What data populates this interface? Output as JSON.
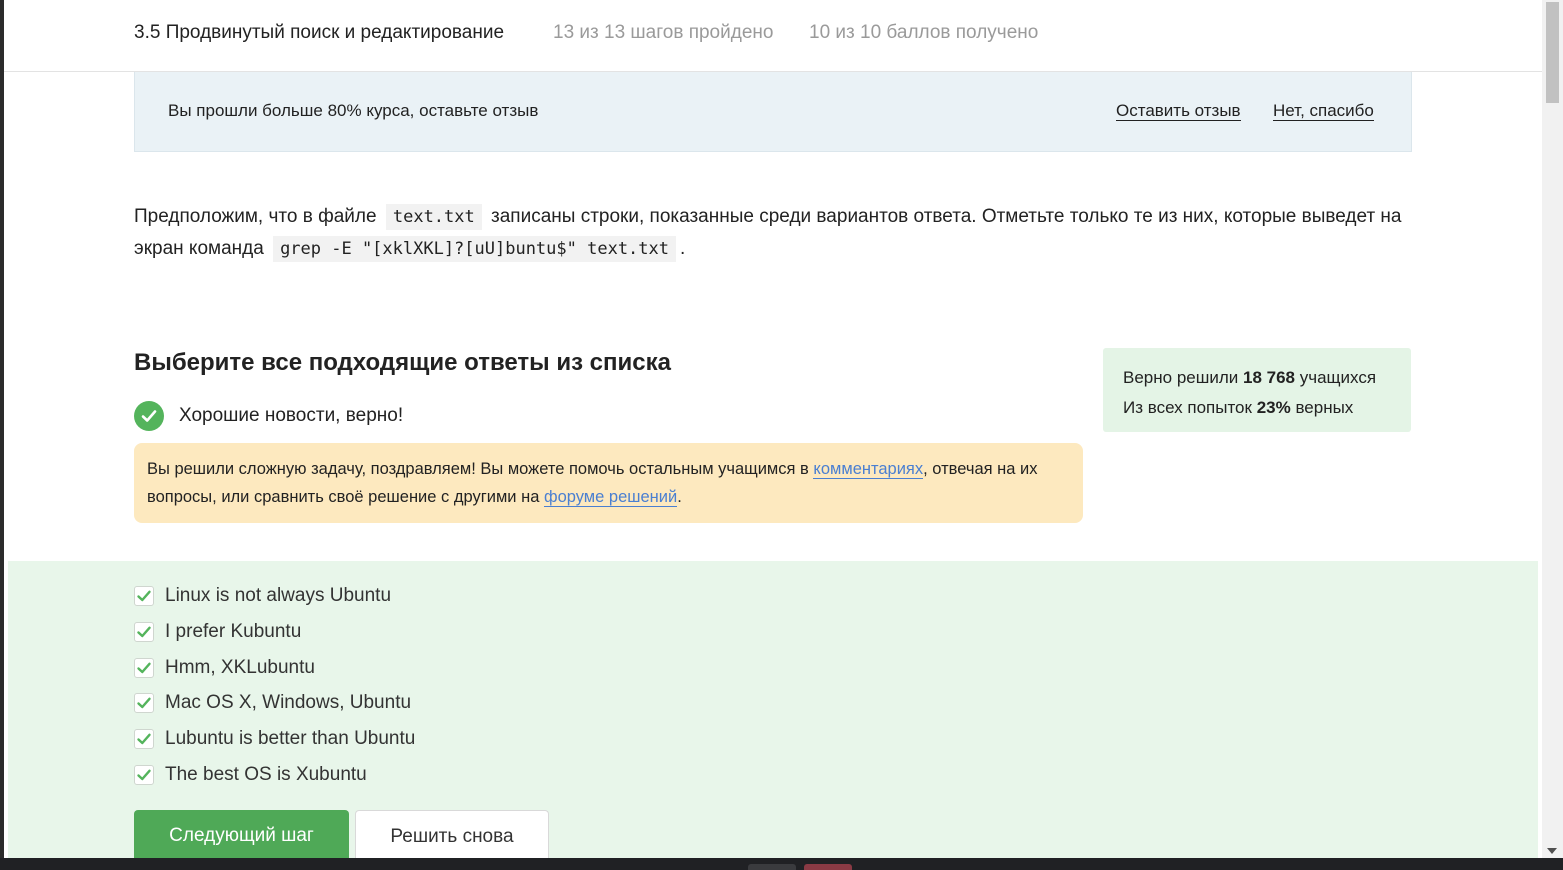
{
  "header": {
    "lesson_title": "3.5 Продвинутый поиск и редактирование",
    "steps_progress": "13 из 13 шагов пройдено",
    "score_progress": "10 из 10 баллов  получено"
  },
  "review_banner": {
    "text": "Вы прошли больше 80% курса, оставьте отзыв",
    "leave_review": "Оставить отзыв",
    "no_thanks": "Нет, спасибо"
  },
  "question": {
    "part1": "Предположим, что в файле",
    "filename": "text.txt",
    "part2": "записаны строки, показанные среди вариантов ответа. Отметьте только те из них, которые выведет на экран команда",
    "command": "grep -E \"[xklXKL]?[uU]buntu$\" text.txt",
    "part3": "."
  },
  "choice_heading": "Выберите все подходящие ответы из списка",
  "result": {
    "text": "Хорошие новости, верно!"
  },
  "stats": {
    "solved_prefix": "Верно решили",
    "solved_count": "18 768",
    "solved_suffix": "учащихся",
    "attempts_prefix": "Из всех попыток",
    "attempts_percent": "23%",
    "attempts_suffix": "верных"
  },
  "notice": {
    "part1": "Вы решили сложную задачу, поздравляем! Вы можете помочь остальным учащимся в",
    "comments_link": "комментариях",
    "part2": ", отвечая на их вопросы, или сравнить своё решение с другими на",
    "forum_link": "форуме решений",
    "part3": "."
  },
  "answers": [
    {
      "label": "Linux is not always Ubuntu",
      "checked": true
    },
    {
      "label": "I prefer Kubuntu",
      "checked": true
    },
    {
      "label": "Hmm, XKLubuntu",
      "checked": true
    },
    {
      "label": "Mac OS X, Windows, Ubuntu",
      "checked": true
    },
    {
      "label": "Lubuntu is better than Ubuntu",
      "checked": true
    },
    {
      "label": "The best OS is Xubuntu",
      "checked": true
    }
  ],
  "buttons": {
    "next_step": "Следующий шаг",
    "solve_again": "Решить снова"
  },
  "colors": {
    "success_green": "#54b45c",
    "button_green": "#4fa957",
    "answers_background": "#e8f6ea",
    "notice_background": "#fde9bf",
    "link_blue": "#4a7fd1"
  }
}
